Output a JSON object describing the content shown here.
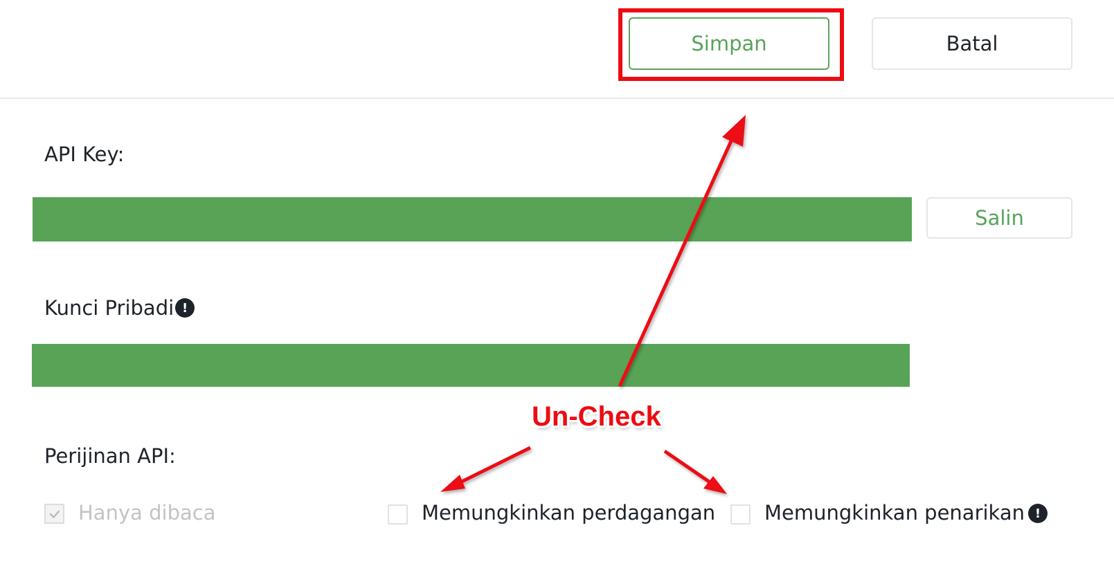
{
  "header": {
    "save_label": "Simpan",
    "cancel_label": "Batal"
  },
  "form": {
    "api_key_label": "API Key:",
    "private_key_label": "Kunci Pribadi",
    "copy_label": "Salin",
    "permissions_label": "Perijinan API:",
    "permissions": [
      {
        "label": "Hanya dibaca",
        "checked": true,
        "disabled": true
      },
      {
        "label": "Memungkinkan perdagangan",
        "checked": false,
        "disabled": false
      },
      {
        "label": "Memungkinkan penarikan",
        "checked": false,
        "disabled": false
      }
    ]
  },
  "annotation": {
    "text": "Un-Check"
  },
  "colors": {
    "accent": "#58a35a",
    "redaction": "#58a356",
    "annotation": "#ec0c12",
    "text": "#1e2329",
    "disabled_text": "#c1c3c7"
  },
  "icons": {
    "info": "exclamation-circle-icon",
    "check": "check-icon"
  }
}
